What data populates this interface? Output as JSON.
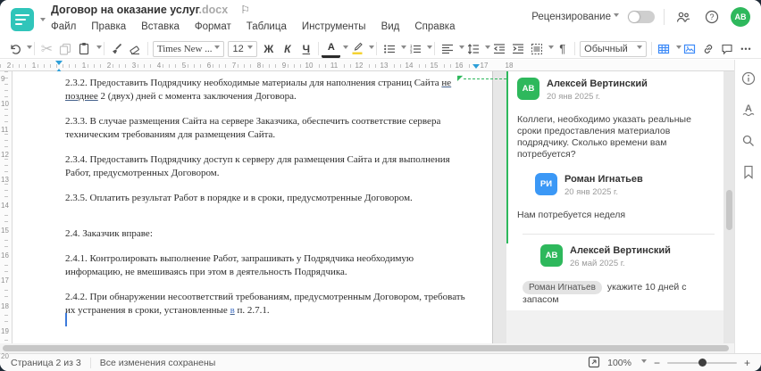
{
  "titlebar": {
    "doc_title": "Договор на оказание услуг",
    "doc_ext": ".docx",
    "review_label": "Рецензирование",
    "review_toggle_on": false,
    "avatar_initials": "АВ"
  },
  "menu": {
    "items": [
      "Файл",
      "Правка",
      "Вставка",
      "Формат",
      "Таблица",
      "Инструменты",
      "Вид",
      "Справка"
    ]
  },
  "icons": {
    "flag": "⚐",
    "scissors": "✂",
    "pilcrow": "¶",
    "more": "•••",
    "arrow": "◤"
  },
  "toolbar": {
    "font_name": "Times New ...",
    "font_size": "12",
    "bold_label": "Ж",
    "italic_label": "К",
    "underline_label": "Ч",
    "font_color_label": "А",
    "style_name": "Обычный"
  },
  "ruler": {
    "h_left_numbers": [
      "2",
      "1"
    ],
    "h_numbers": [
      "1",
      "2",
      "3",
      "4",
      "5",
      "6",
      "7",
      "8",
      "9",
      "10",
      "11",
      "12",
      "13",
      "14",
      "15",
      "16",
      "17",
      "18"
    ],
    "v_numbers": [
      "9",
      "10",
      "11",
      "12",
      "13",
      "14",
      "15",
      "16",
      "17",
      "18",
      "19",
      "20"
    ]
  },
  "colors": {
    "brand_teal": "#30c5ba",
    "accent_green": "#2eb85c",
    "accent_blue": "#3b98f6",
    "toolbar_blue": "#3d8af8",
    "ruler_marker_blue": "#2d9fd8"
  },
  "document": {
    "paragraphs": [
      {
        "mt": 0,
        "segments": [
          {
            "t": "2.3.2. Предоставить Подрядчику необходимые материалы для наполнения страниц Сайта "
          },
          {
            "t": "не\nпозднее",
            "u": true
          },
          {
            "t": " 2 (двух) дней с момента заключения Договора."
          }
        ]
      },
      {
        "mt": 13,
        "segments": [
          {
            "t": "2.3.3. В случае размещения Сайта на сервере Заказчика, обеспечить соответствие сервера\nтехническим требованиям для размещения Сайта."
          }
        ]
      },
      {
        "mt": 13,
        "segments": [
          {
            "t": "2.3.4. Предоставить Подрядчику доступ к серверу для размещения Сайта и для выполнения\nРабот, предусмотренных Договором."
          }
        ]
      },
      {
        "mt": 13,
        "segments": [
          {
            "t": "2.3.5. Оплатить результат Работ в порядке и в сроки, предусмотренные Договором."
          }
        ]
      },
      {
        "mt": 25,
        "segments": [
          {
            "t": "2.4. Заказчик вправе:"
          }
        ]
      },
      {
        "mt": 13,
        "segments": [
          {
            "t": "2.4.1. Контролировать выполнение Работ, запрашивать у Подрядчика необходимую\nинформацию, не вмешиваясь при этом в деятельность Подрядчика."
          }
        ]
      },
      {
        "mt": 13,
        "segments": [
          {
            "t": "2.4.2. При обнаружении несоответствий требованиям, предусмотренным Договором, требовать\nих устранения в сроки, установленные "
          },
          {
            "t": "в",
            "u": true,
            "c": "#4472c4"
          },
          {
            "t": " п. 2.7.1."
          }
        ]
      }
    ]
  },
  "comments": {
    "thread": [
      {
        "initials": "АВ",
        "name": "Алексей Вертинский",
        "date": "20 янв 2025 г.",
        "text": "Коллеги, необходимо указать реальные сроки предоставления материалов подрядчику. Сколько времени вам потребуется?",
        "color": "#2eb85c",
        "indent": false,
        "sep": false
      },
      {
        "initials": "РИ",
        "name": "Роман Игнатьев",
        "date": "20 янв 2025 г.",
        "text": "Нам потребуется неделя",
        "color": "#3b98f6",
        "indent": true,
        "sep": false
      },
      {
        "initials": "АВ",
        "name": "Алексей Вертинский",
        "date": "26 май 2025 г.",
        "mention": "Роман Игнатьев",
        "text": " укажите 10 дней с запасом",
        "color": "#2eb85c",
        "indent": true,
        "sep": true
      }
    ]
  },
  "statusbar": {
    "page_label": "Страница 2 из 3",
    "saved_label": "Все изменения сохранены",
    "zoom_value": "100%"
  }
}
